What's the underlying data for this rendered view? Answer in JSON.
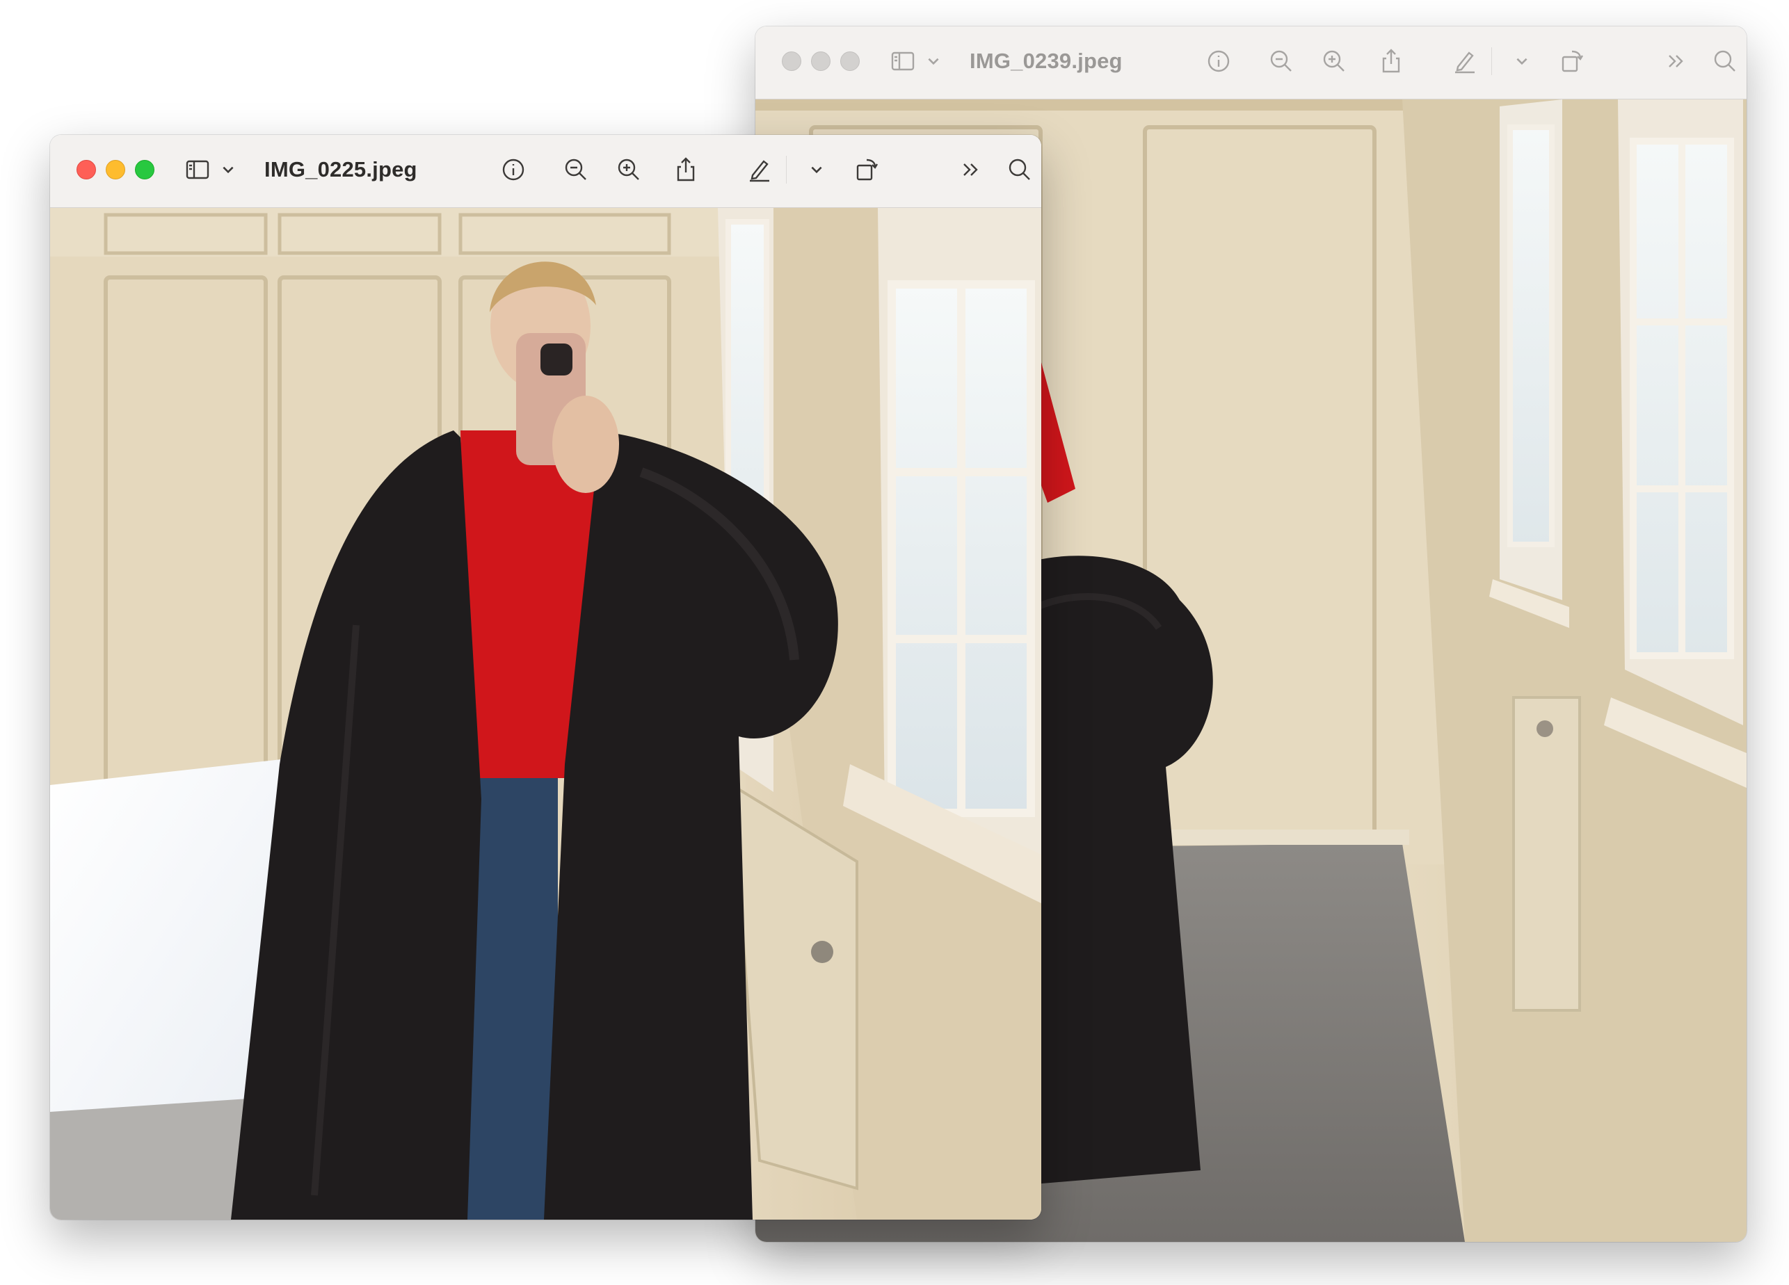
{
  "windows": [
    {
      "id": "back",
      "title": "IMG_0239.jpeg",
      "active": false,
      "photo_description_icon": "photo-standing-mirror-selfie"
    },
    {
      "id": "front",
      "title": "IMG_0225.jpeg",
      "active": true,
      "photo_description_icon": "photo-coat-mirror-selfie"
    }
  ],
  "toolbar_icons": [
    "sidebar-toggle-icon",
    "chevron-down-icon",
    "info-icon",
    "zoom-out-icon",
    "zoom-in-icon",
    "share-icon",
    "markup-pen-icon",
    "rotate-icon",
    "more-tools-icon",
    "search-icon"
  ],
  "colors": {
    "close": "#fe5f57",
    "minimize": "#febc2e",
    "maximize": "#28c840",
    "inactive_dot": "#d3d1cf",
    "titlebar": "#f3f1ef",
    "sweater": "#d0161b",
    "coat": "#1f1c1d",
    "jeans": "#2d4564",
    "wall": "#e8dcc4"
  }
}
